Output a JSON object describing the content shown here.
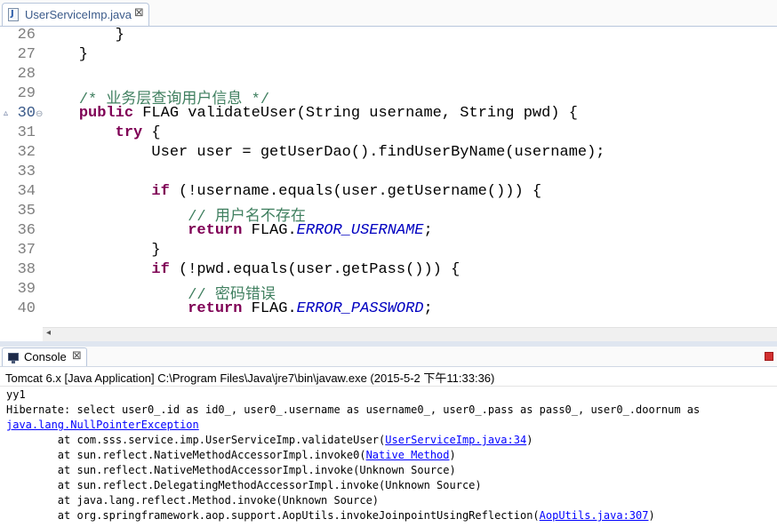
{
  "editor": {
    "tab_title": "UserServiceImp.java",
    "tab_icon_letter": "J",
    "close_glyph": "⊠",
    "overview_marker": "▵",
    "fold_marker": "⊖",
    "lines": [
      {
        "n": "26",
        "segs": [
          {
            "t": "        }",
            "c": "pl"
          }
        ]
      },
      {
        "n": "27",
        "segs": [
          {
            "t": "    }",
            "c": "pl"
          }
        ]
      },
      {
        "n": "28",
        "segs": [
          {
            "t": "",
            "c": "pl"
          }
        ]
      },
      {
        "n": "29",
        "segs": [
          {
            "t": "    ",
            "c": "pl"
          },
          {
            "t": "/* 业务层查询用户信息 */",
            "c": "cm"
          }
        ]
      },
      {
        "n": "30",
        "segs": [
          {
            "t": "    ",
            "c": "pl"
          },
          {
            "t": "public",
            "c": "kw"
          },
          {
            "t": " FLAG validateUser(String username, String pwd) {",
            "c": "pl"
          }
        ]
      },
      {
        "n": "31",
        "segs": [
          {
            "t": "        ",
            "c": "pl"
          },
          {
            "t": "try",
            "c": "kw"
          },
          {
            "t": " {",
            "c": "pl"
          }
        ]
      },
      {
        "n": "32",
        "segs": [
          {
            "t": "            User user = getUserDao().findUserByName(username);",
            "c": "pl"
          }
        ]
      },
      {
        "n": "33",
        "segs": [
          {
            "t": "",
            "c": "pl"
          }
        ]
      },
      {
        "n": "34",
        "segs": [
          {
            "t": "            ",
            "c": "pl"
          },
          {
            "t": "if",
            "c": "kw"
          },
          {
            "t": " (!username.equals(user.getUsername())) {",
            "c": "pl"
          }
        ]
      },
      {
        "n": "35",
        "segs": [
          {
            "t": "                ",
            "c": "pl"
          },
          {
            "t": "// 用户名不存在",
            "c": "cm"
          }
        ]
      },
      {
        "n": "36",
        "segs": [
          {
            "t": "                ",
            "c": "pl"
          },
          {
            "t": "return",
            "c": "kw"
          },
          {
            "t": " FLAG.",
            "c": "pl"
          },
          {
            "t": "ERROR_USERNAME",
            "c": "cn"
          },
          {
            "t": ";",
            "c": "pl"
          }
        ]
      },
      {
        "n": "37",
        "segs": [
          {
            "t": "            }",
            "c": "pl"
          }
        ]
      },
      {
        "n": "38",
        "segs": [
          {
            "t": "            ",
            "c": "pl"
          },
          {
            "t": "if",
            "c": "kw"
          },
          {
            "t": " (!pwd.equals(user.getPass())) {",
            "c": "pl"
          }
        ]
      },
      {
        "n": "39",
        "segs": [
          {
            "t": "                ",
            "c": "pl"
          },
          {
            "t": "// 密码错误",
            "c": "cm"
          }
        ]
      },
      {
        "n": "40",
        "segs": [
          {
            "t": "                ",
            "c": "pl"
          },
          {
            "t": "return",
            "c": "kw"
          },
          {
            "t": " FLAG.",
            "c": "pl"
          },
          {
            "t": "ERROR_PASSWORD",
            "c": "cn"
          },
          {
            "t": ";",
            "c": "pl"
          }
        ]
      }
    ]
  },
  "console": {
    "tab_title": "Console",
    "close_glyph": "⊠",
    "process_info": "Tomcat 6.x [Java Application] C:\\Program Files\\Java\\jre7\\bin\\javaw.exe (2015-5-2 下午11:33:36)",
    "output": [
      {
        "segs": [
          {
            "t": "yy1",
            "c": "pl"
          }
        ]
      },
      {
        "segs": [
          {
            "t": "Hibernate: select user0_.id as id0_, user0_.username as username0_, user0_.pass as pass0_, user0_.doornum as",
            "c": "pl"
          }
        ]
      },
      {
        "segs": [
          {
            "t": "java.lang.NullPointerException",
            "c": "lnk"
          }
        ]
      },
      {
        "segs": [
          {
            "t": "\tat com.sss.service.imp.UserServiceImp.validateUser(",
            "c": "pl"
          },
          {
            "t": "UserServiceImp.java:34",
            "c": "lnk"
          },
          {
            "t": ")",
            "c": "pl"
          }
        ]
      },
      {
        "segs": [
          {
            "t": "\tat sun.reflect.NativeMethodAccessorImpl.invoke0(",
            "c": "pl"
          },
          {
            "t": "Native Method",
            "c": "lnk"
          },
          {
            "t": ")",
            "c": "pl"
          }
        ]
      },
      {
        "segs": [
          {
            "t": "\tat sun.reflect.NativeMethodAccessorImpl.invoke(Unknown Source)",
            "c": "pl"
          }
        ]
      },
      {
        "segs": [
          {
            "t": "\tat sun.reflect.DelegatingMethodAccessorImpl.invoke(Unknown Source)",
            "c": "pl"
          }
        ]
      },
      {
        "segs": [
          {
            "t": "\tat java.lang.reflect.Method.invoke(Unknown Source)",
            "c": "pl"
          }
        ]
      },
      {
        "segs": [
          {
            "t": "\tat org.springframework.aop.support.AopUtils.invokeJoinpointUsingReflection(",
            "c": "pl"
          },
          {
            "t": "AopUtils.java:307",
            "c": "lnk"
          },
          {
            "t": ")",
            "c": "pl"
          }
        ]
      }
    ]
  },
  "scroll_left_glyph": "◂",
  "colors": {
    "keyword": "#7f0055",
    "comment": "#3f7f5f",
    "constant": "#0000c0",
    "link": "#0000ff"
  }
}
